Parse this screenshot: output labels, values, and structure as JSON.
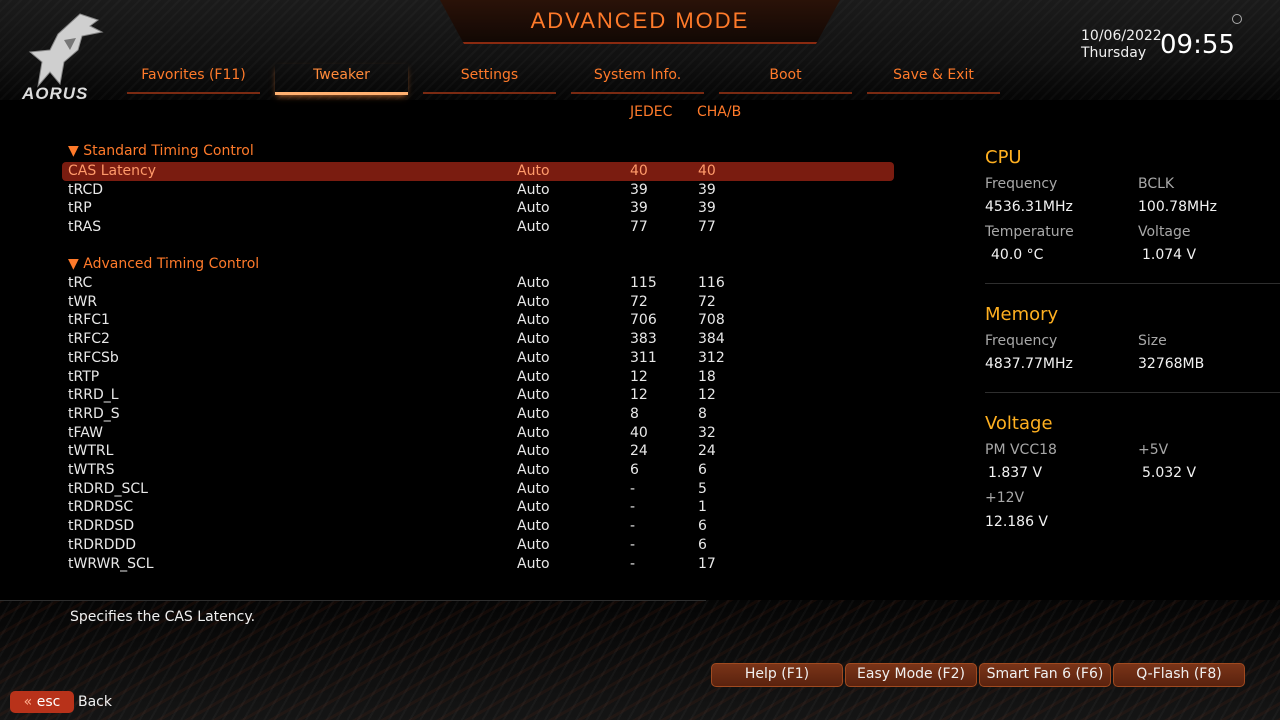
{
  "header": {
    "title": "ADVANCED MODE",
    "brand": "AORUS",
    "date": "10/06/2022",
    "day": "Thursday",
    "time": "09:55"
  },
  "tabs": [
    {
      "label": "Favorites (F11)",
      "active": false
    },
    {
      "label": "Tweaker",
      "active": true
    },
    {
      "label": "Settings",
      "active": false
    },
    {
      "label": "System Info.",
      "active": false
    },
    {
      "label": "Boot",
      "active": false
    },
    {
      "label": "Save & Exit",
      "active": false
    }
  ],
  "columns": {
    "jedec": "JEDEC",
    "cha": "CHA/B"
  },
  "sections": {
    "standard": "Standard Timing Control",
    "advanced": "Advanced Timing Control"
  },
  "standard_rows": [
    {
      "name": "CAS Latency",
      "mode": "Auto",
      "jedec": "40",
      "cha": "40"
    },
    {
      "name": "tRCD",
      "mode": "Auto",
      "jedec": "39",
      "cha": "39"
    },
    {
      "name": "tRP",
      "mode": "Auto",
      "jedec": "39",
      "cha": "39"
    },
    {
      "name": "tRAS",
      "mode": "Auto",
      "jedec": "77",
      "cha": "77"
    }
  ],
  "advanced_rows": [
    {
      "name": "tRC",
      "mode": "Auto",
      "jedec": "115",
      "cha": "116"
    },
    {
      "name": "tWR",
      "mode": "Auto",
      "jedec": "72",
      "cha": "72"
    },
    {
      "name": "tRFC1",
      "mode": "Auto",
      "jedec": "706",
      "cha": "708"
    },
    {
      "name": "tRFC2",
      "mode": "Auto",
      "jedec": "383",
      "cha": "384"
    },
    {
      "name": "tRFCSb",
      "mode": "Auto",
      "jedec": "311",
      "cha": "312"
    },
    {
      "name": "tRTP",
      "mode": "Auto",
      "jedec": "12",
      "cha": "18"
    },
    {
      "name": "tRRD_L",
      "mode": "Auto",
      "jedec": "12",
      "cha": "12"
    },
    {
      "name": "tRRD_S",
      "mode": "Auto",
      "jedec": "8",
      "cha": "8"
    },
    {
      "name": "tFAW",
      "mode": "Auto",
      "jedec": "40",
      "cha": "32"
    },
    {
      "name": "tWTRL",
      "mode": "Auto",
      "jedec": "24",
      "cha": "24"
    },
    {
      "name": "tWTRS",
      "mode": "Auto",
      "jedec": "6",
      "cha": "6"
    },
    {
      "name": "tRDRD_SCL",
      "mode": "Auto",
      "jedec": "-",
      "cha": "5"
    },
    {
      "name": "tRDRDSC",
      "mode": "Auto",
      "jedec": "-",
      "cha": "1"
    },
    {
      "name": "tRDRDSD",
      "mode": "Auto",
      "jedec": "-",
      "cha": "6"
    },
    {
      "name": "tRDRDDD",
      "mode": "Auto",
      "jedec": "-",
      "cha": "6"
    },
    {
      "name": "tWRWR_SCL",
      "mode": "Auto",
      "jedec": "-",
      "cha": "17"
    }
  ],
  "help_text": "Specifies the CAS Latency.",
  "cpu": {
    "title": "CPU",
    "freq_label": "Frequency",
    "freq_value": "4536.31MHz",
    "bclk_label": "BCLK",
    "bclk_value": "100.78MHz",
    "temp_label": "Temperature",
    "temp_value": "40.0 °C",
    "volt_label": "Voltage",
    "volt_value": "1.074 V"
  },
  "memory": {
    "title": "Memory",
    "freq_label": "Frequency",
    "freq_value": "4837.77MHz",
    "size_label": "Size",
    "size_value": "32768MB"
  },
  "voltage": {
    "title": "Voltage",
    "pm_label": "PM VCC18",
    "pm_value": "1.837 V",
    "v5_label": "+5V",
    "v5_value": "5.032 V",
    "v12_label": "+12V",
    "v12_value": "12.186 V"
  },
  "footer": {
    "help": "Help (F1)",
    "easy": "Easy Mode (F2)",
    "fan": "Smart Fan 6 (F6)",
    "qflash": "Q-Flash (F8)",
    "esc": "esc",
    "back": "Back"
  },
  "colors": {
    "accent": "#ff7a2a",
    "selected_row": "#7a1c10",
    "panel_title": "#ffb020"
  }
}
